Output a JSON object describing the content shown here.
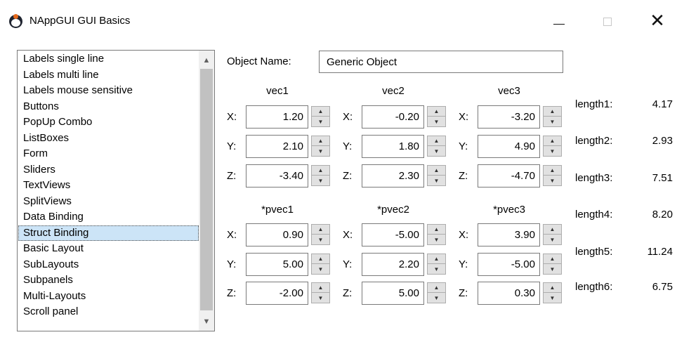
{
  "window": {
    "title": "NAppGUI GUI Basics"
  },
  "list": {
    "items": [
      "Labels single line",
      "Labels multi line",
      "Labels mouse sensitive",
      "Buttons",
      "PopUp Combo",
      "ListBoxes",
      "Form",
      "Sliders",
      "TextViews",
      "SplitViews",
      "Data Binding",
      "Struct Binding",
      "Basic Layout",
      "SubLayouts",
      "Subpanels",
      "Multi-Layouts",
      "Scroll panel"
    ],
    "selected": "Struct Binding"
  },
  "form": {
    "object_name_label": "Object Name:",
    "object_name_value": "Generic Object",
    "axis_labels": {
      "x": "X:",
      "y": "Y:",
      "z": "Z:"
    },
    "vectors": [
      {
        "title": "vec1",
        "x": "1.20",
        "y": "2.10",
        "z": "-3.40"
      },
      {
        "title": "vec2",
        "x": "-0.20",
        "y": "1.80",
        "z": "2.30"
      },
      {
        "title": "vec3",
        "x": "-3.20",
        "y": "4.90",
        "z": "-4.70"
      }
    ],
    "pvectors": [
      {
        "title": "*pvec1",
        "x": "0.90",
        "y": "5.00",
        "z": "-2.00"
      },
      {
        "title": "*pvec2",
        "x": "-5.00",
        "y": "2.20",
        "z": "5.00"
      },
      {
        "title": "*pvec3",
        "x": "3.90",
        "y": "-5.00",
        "z": "0.30"
      }
    ]
  },
  "lengths": [
    {
      "label": "length1:",
      "value": "4.17"
    },
    {
      "label": "length2:",
      "value": "2.93"
    },
    {
      "label": "length3:",
      "value": "7.51"
    },
    {
      "label": "length4:",
      "value": "8.20"
    },
    {
      "label": "length5:",
      "value": "11.24"
    },
    {
      "label": "length6:",
      "value": "6.75"
    }
  ]
}
